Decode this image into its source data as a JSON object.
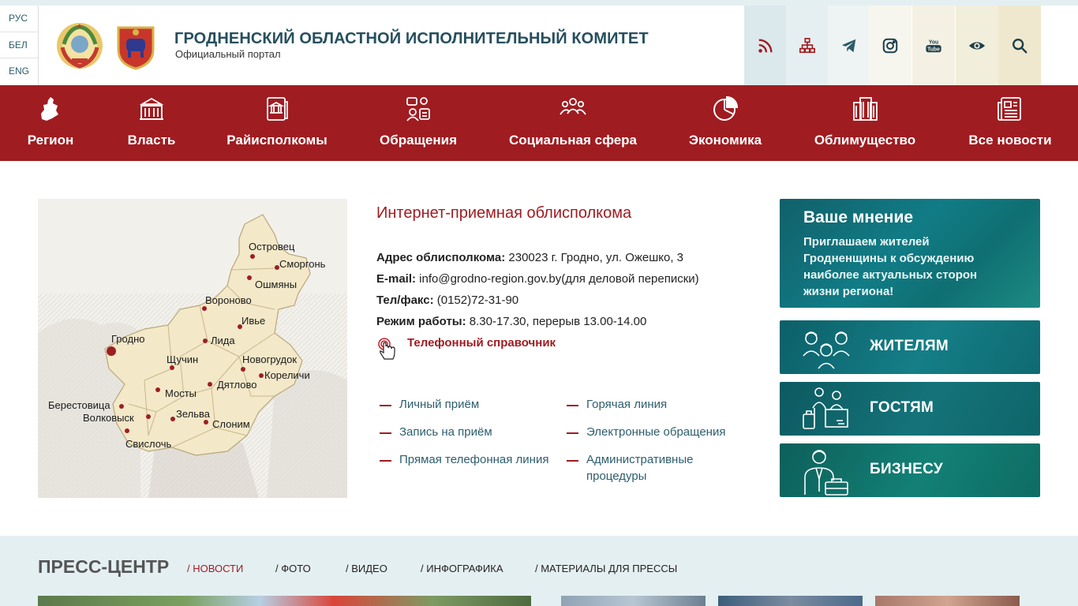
{
  "languages": [
    "РУС",
    "БЕЛ",
    "ENG"
  ],
  "header": {
    "title": "ГРОДНЕНСКИЙ ОБЛАСТНОЙ ИСПОЛНИТЕЛЬНЫЙ КОМИТЕТ",
    "subtitle": "Официальный портал"
  },
  "tools": [
    {
      "icon": "rss-icon",
      "bg": "#dbe9ed"
    },
    {
      "icon": "sitemap-icon",
      "bg": "#e5eff1"
    },
    {
      "icon": "telegram-icon",
      "bg": "#eef4f3"
    },
    {
      "icon": "instagram-icon",
      "bg": "#f6f6ee"
    },
    {
      "icon": "youtube-icon",
      "bg": "#f4f1e4"
    },
    {
      "icon": "eye-icon",
      "bg": "#f2eedc"
    },
    {
      "icon": "search-icon",
      "bg": "#efe8cf"
    }
  ],
  "nav": [
    {
      "label": "Регион",
      "icon": "region-map-icon"
    },
    {
      "label": "Власть",
      "icon": "government-building-icon"
    },
    {
      "label": "Райисполкомы",
      "icon": "district-committee-icon"
    },
    {
      "label": "Обращения",
      "icon": "appeals-icon"
    },
    {
      "label": "Социальная сфера",
      "icon": "people-group-icon"
    },
    {
      "label": "Экономика",
      "icon": "pie-chart-icon"
    },
    {
      "label": "Облимущество",
      "icon": "office-building-icon"
    },
    {
      "label": "Все новости",
      "icon": "newspaper-icon"
    }
  ],
  "map": {
    "cities": [
      "Островец",
      "Сморгонь",
      "Ошмяны",
      "Вороново",
      "Ивье",
      "Гродно",
      "Лида",
      "Щучин",
      "Новогрудок",
      "Кореличи",
      "Дятлово",
      "Мосты",
      "Берестовица",
      "Волковыск",
      "Зельва",
      "Слоним",
      "Свислочь"
    ]
  },
  "contact": {
    "title": "Интернет-приемная облисполкома",
    "address_label": "Адрес облисполкома:",
    "address": " 230023 г. Гродно, ул. Ожешко, 3",
    "email_label": "E-mail:",
    "email": " info@grodno-region.gov.by(для деловой переписки)",
    "phone_label": "Тел/факс:",
    "phone": " (0152)72-31-90",
    "hours_label": "Режим работы:",
    "hours": " 8.30-17.30, перерыв 13.00-14.00",
    "phonebook": "Телефонный справочник"
  },
  "links": [
    "Личный приём",
    "Горячая линия",
    "Запись на приём",
    "Электронные обращения",
    "Прямая телефонная линия",
    "Административные процедуры"
  ],
  "opinion": {
    "title": "Ваше мнение",
    "text": "Приглашаем жителей Гродненщины к обсуждению наиболее актуальных сторон жизни региона!"
  },
  "tiles": [
    {
      "label": "ЖИТЕЛЯМ",
      "icon": "residents-icon"
    },
    {
      "label": "ГОСТЯМ",
      "icon": "guests-icon"
    },
    {
      "label": "БИЗНЕСУ",
      "icon": "business-icon"
    }
  ],
  "press": {
    "title": "ПРЕСС-ЦЕНТР",
    "tabs": [
      "/ НОВОСТИ",
      "/ ФОТО",
      "/ ВИДЕО",
      "/ ИНФОГРАФИКА",
      "/ МАТЕРИАЛЫ ДЛЯ ПРЕССЫ"
    ]
  },
  "colors": {
    "brand_red": "#9f1c21",
    "teal_dark": "#264f5e",
    "teal_panel": "#117c86"
  }
}
